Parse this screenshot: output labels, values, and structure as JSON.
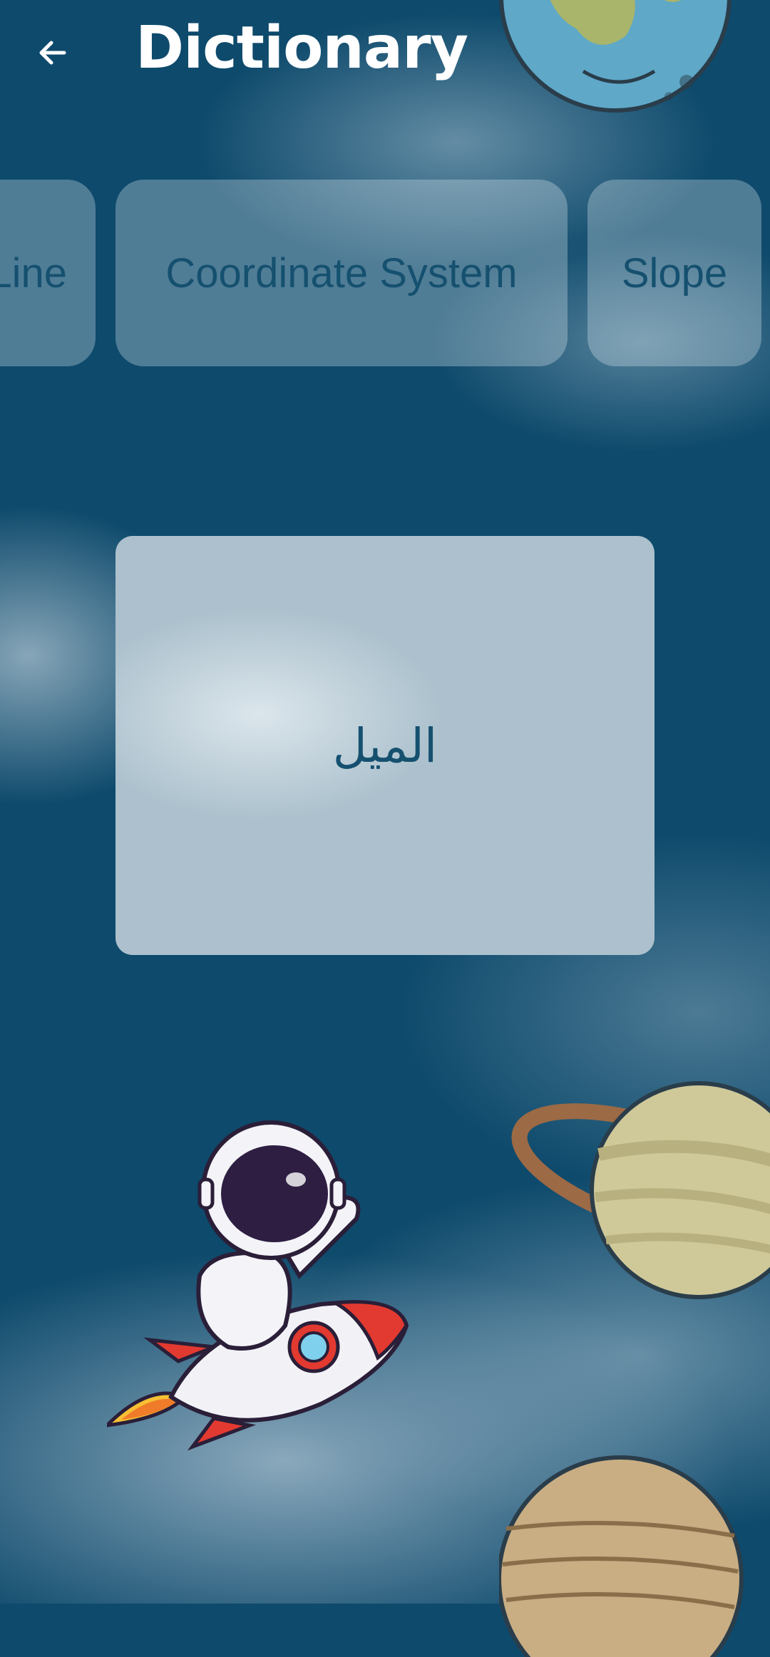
{
  "header": {
    "title": "Dictionary",
    "back_icon": "arrow-left-icon"
  },
  "chips": [
    {
      "label": "Line"
    },
    {
      "label": "Coordinate System"
    },
    {
      "label": "Slope"
    }
  ],
  "card": {
    "translation": "الميل"
  },
  "colors": {
    "background": "#0e4a6c",
    "chip_text": "#15506f",
    "card_bg": "#acc1cd",
    "title_text": "#ffffff"
  },
  "decor": [
    "earth-illustration",
    "saturn-illustration",
    "jupiter-illustration",
    "astronaut-on-rocket-illustration"
  ]
}
